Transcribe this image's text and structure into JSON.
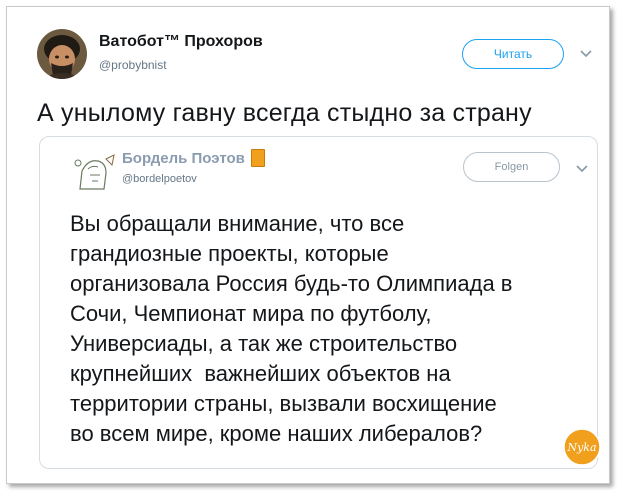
{
  "tweet": {
    "author": {
      "name": "Ватобот™ Прохоров",
      "handle": "@probybnist"
    },
    "follow_label": "Читать",
    "text": "А унылому гавну всегда стыдно за страну",
    "icons": [
      "avatar",
      "chevron-down-icon"
    ]
  },
  "quoted": {
    "author": {
      "name": "Бордель Поэтов",
      "handle": "@bordelpoetov"
    },
    "follow_label": "Folgen",
    "lines": [
      "Вы обращали внимание, что все",
      "грандиозные проекты, которые",
      "организовала Россия будь-то Олимпиада в",
      "Сочи, Чемпионат мира по футболу,",
      "Универсиады, а так же строительство",
      "крупнейших  важнейших объектов на",
      "территории страны, вызвали восхищение",
      "во всем мире, кроме наших либералов?"
    ],
    "icons": [
      "book-icon",
      "chevron-down-icon"
    ]
  },
  "watermark": {
    "text": "Nyka"
  },
  "colors": {
    "accent": "#1da1f2",
    "text": "#14171a",
    "muted": "#657786",
    "badge": "#f0a01c"
  }
}
